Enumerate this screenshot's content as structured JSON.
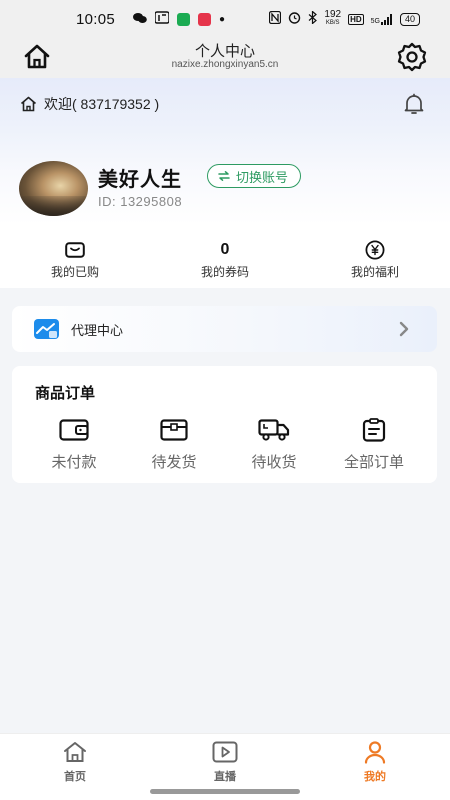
{
  "status_bar": {
    "time": "10:05",
    "net_speed_value": "192",
    "net_speed_unit": "KB/S",
    "hd": "HD",
    "signal": "5G",
    "battery": "40"
  },
  "header": {
    "title": "个人中心",
    "subtitle": "nazixe.zhongxinyan5.cn"
  },
  "welcome": {
    "text": "欢迎( 837179352 )"
  },
  "profile": {
    "username": "美好人生",
    "switch_label": "切换账号",
    "user_id": "ID: 13295808"
  },
  "stats": [
    {
      "icon": "wallet-icon",
      "count": "",
      "label": "我的已购"
    },
    {
      "icon": "",
      "count": "0",
      "label": "我的券码"
    },
    {
      "icon": "yen-icon",
      "count": "",
      "label": "我的福利"
    }
  ],
  "agent": {
    "label": "代理中心"
  },
  "orders": {
    "title": "商品订单",
    "items": [
      {
        "icon": "wallet-icon",
        "label": "未付款"
      },
      {
        "icon": "box-icon",
        "label": "待发货"
      },
      {
        "icon": "truck-icon",
        "label": "待收货"
      },
      {
        "icon": "clipboard-icon",
        "label": "全部订单"
      }
    ]
  },
  "tabs": [
    {
      "icon": "home-icon",
      "label": "首页",
      "active": false
    },
    {
      "icon": "play-icon",
      "label": "直播",
      "active": false
    },
    {
      "icon": "user-icon",
      "label": "我的",
      "active": true
    }
  ],
  "colors": {
    "accent_green": "#2e9b62",
    "accent_orange": "#ee7a25",
    "agent_blue": "#1d8ceb"
  }
}
